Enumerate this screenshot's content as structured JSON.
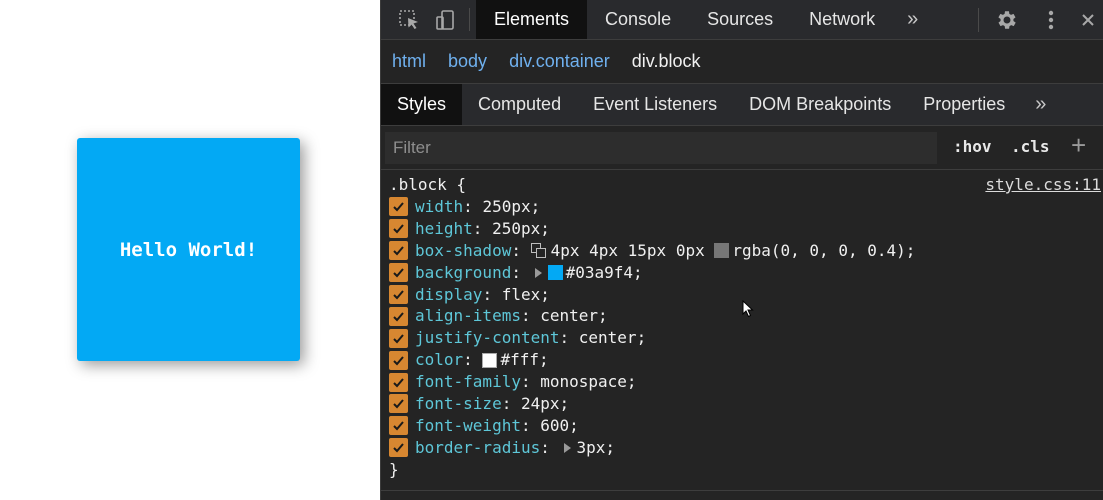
{
  "preview": {
    "block_text": "Hello World!"
  },
  "devtools": {
    "main_tabs": [
      "Elements",
      "Console",
      "Sources",
      "Network"
    ],
    "more_glyph": "»",
    "breadcrumb": [
      "html",
      "body",
      "div.container",
      "div.block"
    ],
    "sub_tabs": [
      "Styles",
      "Computed",
      "Event Listeners",
      "DOM Breakpoints",
      "Properties"
    ],
    "filter_placeholder": "Filter",
    "hov_label": ":hov",
    "cls_label": ".cls",
    "plus_glyph": "+",
    "rule": {
      "selector": ".block {",
      "source": "style.css:11",
      "closing": "}",
      "declarations": [
        {
          "prop": "width",
          "value": "250px;"
        },
        {
          "prop": "height",
          "value": "250px;"
        },
        {
          "prop": "box-shadow",
          "value_a": "4px 4px 15px 0px ",
          "value_b": "rgba(0, 0, 0, 0.4);"
        },
        {
          "prop": "background",
          "value": "#03a9f4;"
        },
        {
          "prop": "display",
          "value": "flex;"
        },
        {
          "prop": "align-items",
          "value": "center;"
        },
        {
          "prop": "justify-content",
          "value": "center;"
        },
        {
          "prop": "color",
          "value": "#fff;"
        },
        {
          "prop": "font-family",
          "value": "monospace;"
        },
        {
          "prop": "font-size",
          "value": "24px;"
        },
        {
          "prop": "font-weight",
          "value": "600;"
        },
        {
          "prop": "border-radius",
          "value": "3px;"
        }
      ]
    },
    "colors": {
      "checkbox": "#d78731",
      "property": "#5ec7d8",
      "link": "#6fb0ee",
      "swatch_background": "#03a9f4",
      "swatch_color": "#ffffff",
      "swatch_shadow": "#777777"
    }
  }
}
